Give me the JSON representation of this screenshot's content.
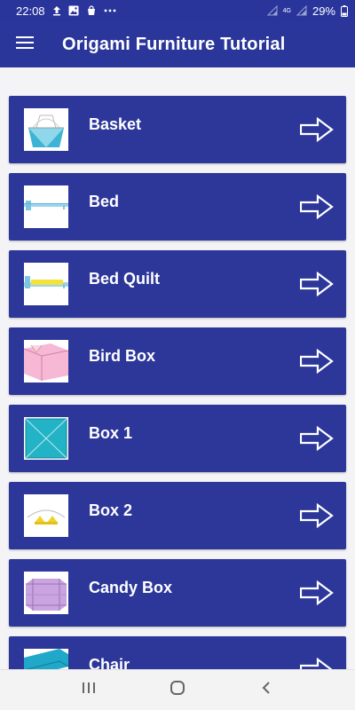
{
  "status_bar": {
    "time": "22:08",
    "battery": "29%",
    "network": "4G",
    "icons": [
      "upload-icon",
      "image-icon",
      "bag-icon",
      "more-dots-icon",
      "signal-icon",
      "signal-icon",
      "battery-icon"
    ]
  },
  "app_bar": {
    "title": "Origami Furniture Tutorial",
    "menu_icon": "hamburger-menu-icon"
  },
  "colors": {
    "primary": "#2b369a",
    "item_background": "#2c3799",
    "text": "#ffffff"
  },
  "list": {
    "items": [
      {
        "label": "Basket",
        "thumb": "basket"
      },
      {
        "label": "Bed",
        "thumb": "bed"
      },
      {
        "label": "Bed Quilt",
        "thumb": "bed-quilt"
      },
      {
        "label": "Bird Box",
        "thumb": "bird-box"
      },
      {
        "label": "Box 1",
        "thumb": "box-1"
      },
      {
        "label": "Box 2",
        "thumb": "box-2"
      },
      {
        "label": "Candy Box",
        "thumb": "candy-box"
      },
      {
        "label": "Chair",
        "thumb": "chair"
      }
    ],
    "arrow_icon": "arrow-right-icon"
  },
  "nav_bar": {
    "buttons": [
      "recent-apps-icon",
      "home-icon",
      "back-icon"
    ]
  }
}
